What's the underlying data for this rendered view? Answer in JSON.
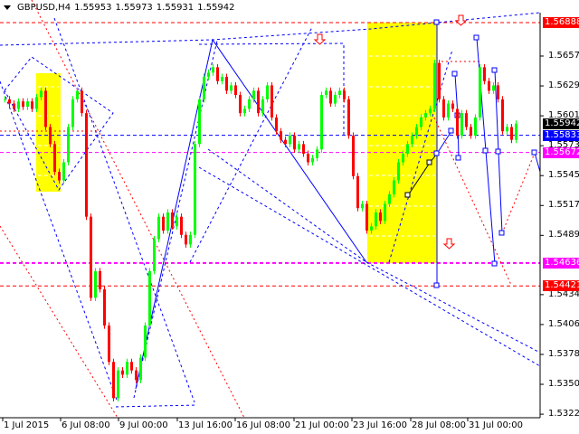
{
  "header": {
    "symbol": "GBPUSD,H4",
    "open": "1.55953",
    "high": "1.55973",
    "low": "1.55931",
    "close": "1.55942"
  },
  "colors": {
    "bull": "#00ff00",
    "bear": "#ff0000",
    "red_line": "#ff0000",
    "blue_line": "#0000ff",
    "magenta_line": "#ff00ff",
    "zone": "#ffff00"
  },
  "chart_data": {
    "type": "candlestick",
    "title": "GBPUSD,H4",
    "ylim": [
      1.5315,
      1.5717
    ],
    "first_open": 1.5617,
    "closes": [
      1.5617,
      1.5613,
      1.5608,
      1.5615,
      1.561,
      1.5615,
      1.5608,
      1.5619,
      1.5625,
      1.5591,
      1.5575,
      1.5549,
      1.5541,
      1.5558,
      1.5591,
      1.5617,
      1.5625,
      1.5604,
      1.5507,
      1.5431,
      1.5456,
      1.5439,
      1.5405,
      1.5371,
      1.5337,
      1.5363,
      1.5359,
      1.5371,
      1.5363,
      1.5354,
      1.5375,
      1.5405,
      1.5456,
      1.5486,
      1.5507,
      1.5494,
      1.5511,
      1.5498,
      1.5507,
      1.549,
      1.5481,
      1.549,
      1.5575,
      1.5617,
      1.5638,
      1.5642,
      1.5647,
      1.5634,
      1.5638,
      1.5625,
      1.563,
      1.5621,
      1.5604,
      1.5608,
      1.5617,
      1.5625,
      1.5604,
      1.5617,
      1.563,
      1.56,
      1.5587,
      1.5579,
      1.5575,
      1.5583,
      1.557,
      1.5575,
      1.5566,
      1.5558,
      1.5562,
      1.557,
      1.5621,
      1.5625,
      1.5613,
      1.5621,
      1.5625,
      1.5617,
      1.5583,
      1.5545,
      1.5515,
      1.5519,
      1.5494,
      1.5498,
      1.5511,
      1.5503,
      1.5519,
      1.5528,
      1.5541,
      1.5558,
      1.5566,
      1.5575,
      1.5583,
      1.5591,
      1.56,
      1.5604,
      1.5608,
      1.5651,
      1.5617,
      1.56,
      1.5613,
      1.5608,
      1.5583,
      1.5604,
      1.5591,
      1.5583,
      1.56,
      1.5647,
      1.5634,
      1.5625,
      1.563,
      1.5617,
      1.5587,
      1.5591,
      1.5579,
      1.55942
    ],
    "y_ticks": [
      "1.56575",
      "1.56295",
      "1.56015",
      "1.55735",
      "1.55455",
      "1.55175",
      "1.54895",
      "1.54340",
      "1.54060",
      "1.53780",
      "1.53500",
      "1.53220"
    ],
    "x_ticks": [
      "1 Jul 2015",
      "6 Jul 08:00",
      "9 Jul 00:00",
      "13 Jul 16:00",
      "16 Jul 08:00",
      "21 Jul 00:00",
      "23 Jul 16:00",
      "28 Jul 08:00",
      "31 Jul 00:00"
    ],
    "price_levels": [
      {
        "label": "1.56888",
        "value": 1.56888,
        "color": "#ff0000",
        "text_color": "#ffffff"
      },
      {
        "label": "1.55942",
        "value": 1.55942,
        "color": "#000000",
        "text_color": "#ffffff"
      },
      {
        "label": "1.55833",
        "value": 1.55833,
        "color": "#0000ff",
        "text_color": "#ffffff"
      },
      {
        "label": "1.55672",
        "value": 1.55672,
        "color": "#ff00ff",
        "text_color": "#ffffff"
      },
      {
        "label": "1.54636",
        "value": 1.54636,
        "color": "#ff00ff",
        "text_color": "#ffffff"
      },
      {
        "label": "1.54421",
        "value": 1.54421,
        "color": "#ff0000",
        "text_color": "#ffffff"
      }
    ]
  }
}
